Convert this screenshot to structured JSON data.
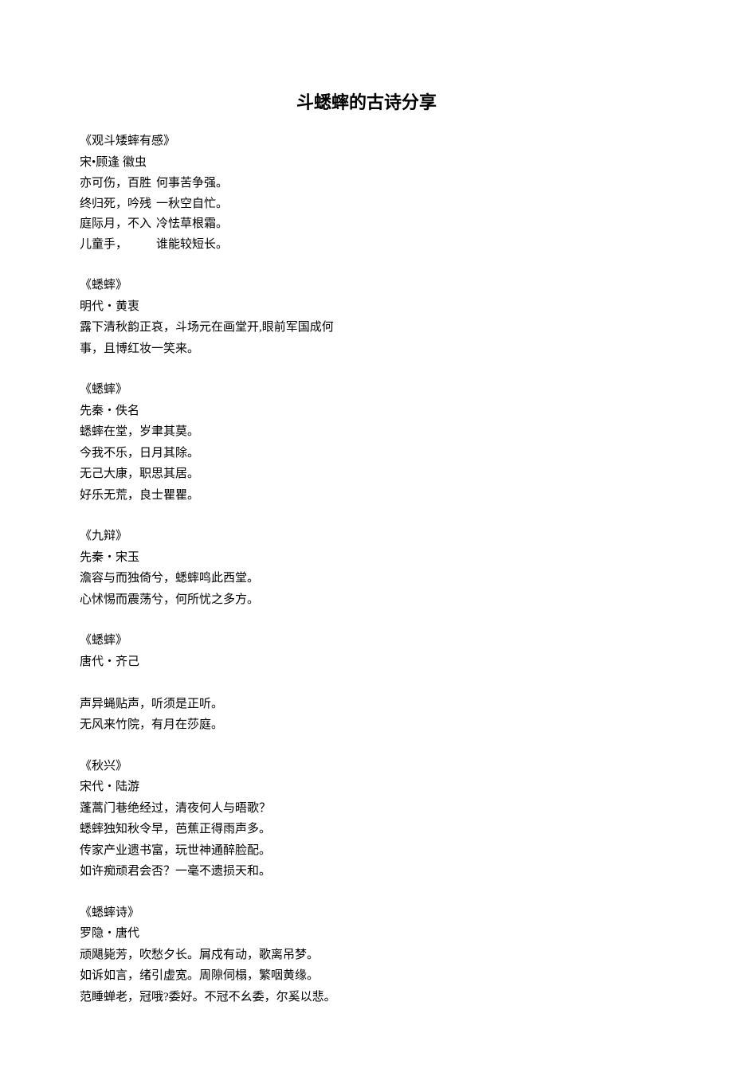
{
  "title": "斗蟋蟀的古诗分享",
  "poems": [
    {
      "title": "《观斗矮蟀有感》",
      "author": "宋•顾逢  徽虫",
      "col1": [
        "亦可伤，百胜",
        "终归死，吟残",
        "庭际月，不入",
        "儿童手，"
      ],
      "col2": [
        "何事苦争强。",
        "一秋空自忙。",
        "冷怯草根霜。",
        "谁能较短长。"
      ]
    },
    {
      "title": "《蟋蟀》",
      "author": "明代・黄衷",
      "lines": [
        "露下清秋韵正哀，斗场元在画堂开,眼前军国成何",
        "事，且博红妆一笑来。"
      ]
    },
    {
      "title": "《蟋蟀》",
      "author": "先秦・佚名",
      "lines": [
        "蟋蟀在堂，岁聿其莫。",
        "今我不乐，日月其除。",
        "无己大康，职思其居。",
        "好乐无荒，良士瞿瞿。"
      ]
    },
    {
      "title": "《九辩》",
      "author": "先秦・宋玉",
      "lines": [
        "澹容与而独倚兮，蟋蟀鸣此西堂。",
        "心怵惕而震荡兮，何所忧之多方。"
      ]
    },
    {
      "title": "《蟋蟀》",
      "author": "唐代・齐己",
      "lines": [
        "",
        "声异蝇贴声，听须是正听。",
        "无风来竹院，有月在莎庭。"
      ]
    },
    {
      "title": "《秋兴》",
      "author": "宋代・陆游",
      "lines": [
        "蓬蒿门巷绝经过，清夜何人与晤歌？",
        "蟋蟀独知秋令早，芭蕉正得雨声多。",
        "传家产业遗书富，玩世神通醉脸配。",
        "如许痴顽君会否？一毫不遗损天和。"
      ]
    },
    {
      "title": "《蟋蟀诗》",
      "author": "罗隐・唐代",
      "lines": [
        "顽飓毙芳，吹愁夕长。屑戍有动，歌离吊梦。",
        "如诉如言，绪引虚宽。周隙伺榻，繁咽黄缘。",
        "范睡蝉老，冠哦?委好。不冠不幺委，尔奚以悲。"
      ]
    }
  ]
}
